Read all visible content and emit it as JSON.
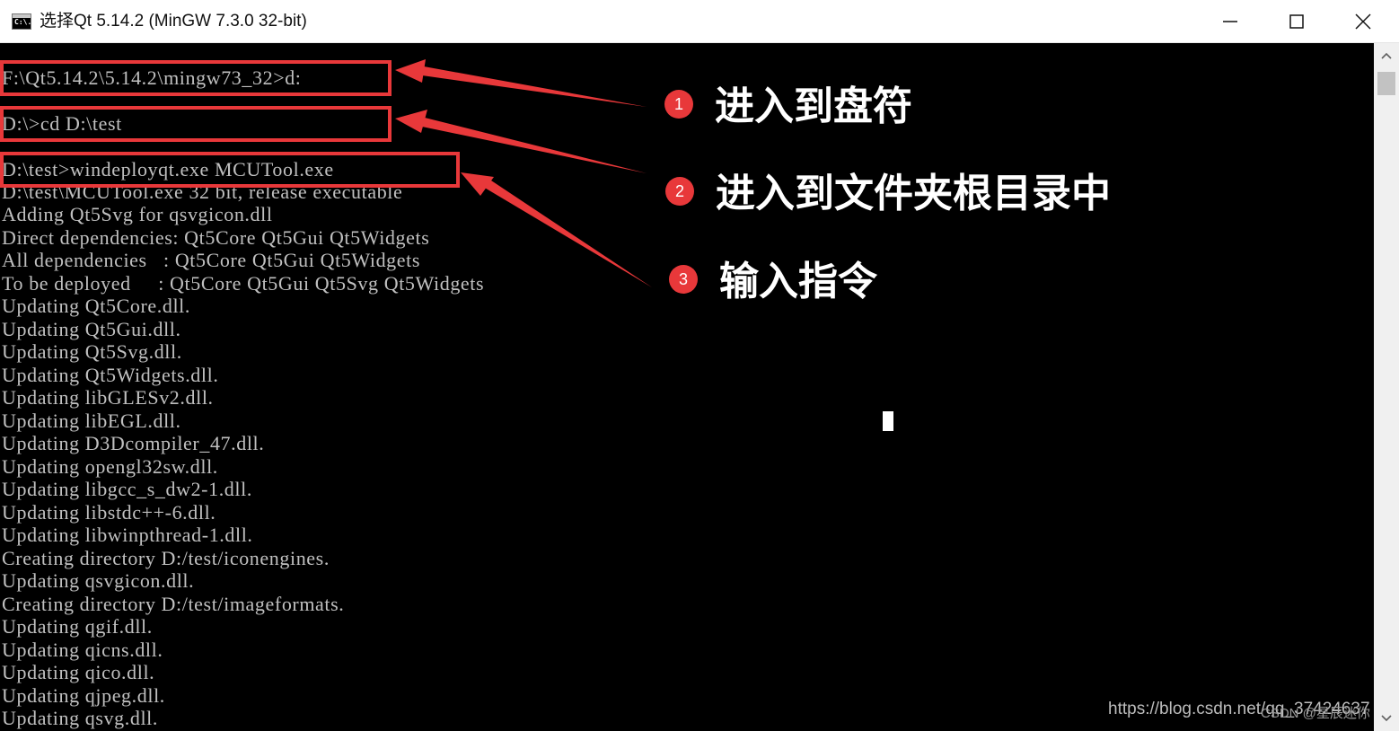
{
  "window": {
    "title": "选择Qt 5.14.2 (MinGW 7.3.0 32-bit)",
    "icon_text": "C:\\.",
    "icon": "console-icon"
  },
  "controls": {
    "minimize_icon": "minimize-icon",
    "maximize_icon": "maximize-icon",
    "close_icon": "close-icon"
  },
  "console": {
    "lines": [
      "F:\\Qt5.14.2\\5.14.2\\mingw73_32>d:",
      "",
      "D:\\>cd D:\\test",
      "",
      "D:\\test>windeployqt.exe MCUTool.exe",
      "D:\\test\\MCUTool.exe 32 bit, release executable",
      "Adding Qt5Svg for qsvgicon.dll",
      "Direct dependencies: Qt5Core Qt5Gui Qt5Widgets",
      "All dependencies   : Qt5Core Qt5Gui Qt5Widgets",
      "To be deployed     : Qt5Core Qt5Gui Qt5Svg Qt5Widgets",
      "Updating Qt5Core.dll.",
      "Updating Qt5Gui.dll.",
      "Updating Qt5Svg.dll.",
      "Updating Qt5Widgets.dll.",
      "Updating libGLESv2.dll.",
      "Updating libEGL.dll.",
      "Updating D3Dcompiler_47.dll.",
      "Updating opengl32sw.dll.",
      "Updating libgcc_s_dw2-1.dll.",
      "Updating libstdc++-6.dll.",
      "Updating libwinpthread-1.dll.",
      "Creating directory D:/test/iconengines.",
      "Updating qsvgicon.dll.",
      "Creating directory D:/test/imageformats.",
      "Updating qgif.dll.",
      "Updating qicns.dll.",
      "Updating qico.dll.",
      "Updating qjpeg.dll.",
      "Updating qsvg.dll."
    ],
    "text_color": "#c0c0c0",
    "background": "#000000"
  },
  "annotations": {
    "color": "#e8383a",
    "steps": [
      {
        "number": "1",
        "label": "进入到盘符"
      },
      {
        "number": "2",
        "label": "进入到文件夹根目录中"
      },
      {
        "number": "3",
        "label": "输入指令"
      }
    ]
  },
  "watermark": {
    "url": "https://blog.csdn.net/qq_37424637",
    "author": "CSDN @星辰迷你"
  },
  "scrollbar": {
    "up_icon": "chevron-up-icon",
    "down_icon": "chevron-down-icon"
  }
}
